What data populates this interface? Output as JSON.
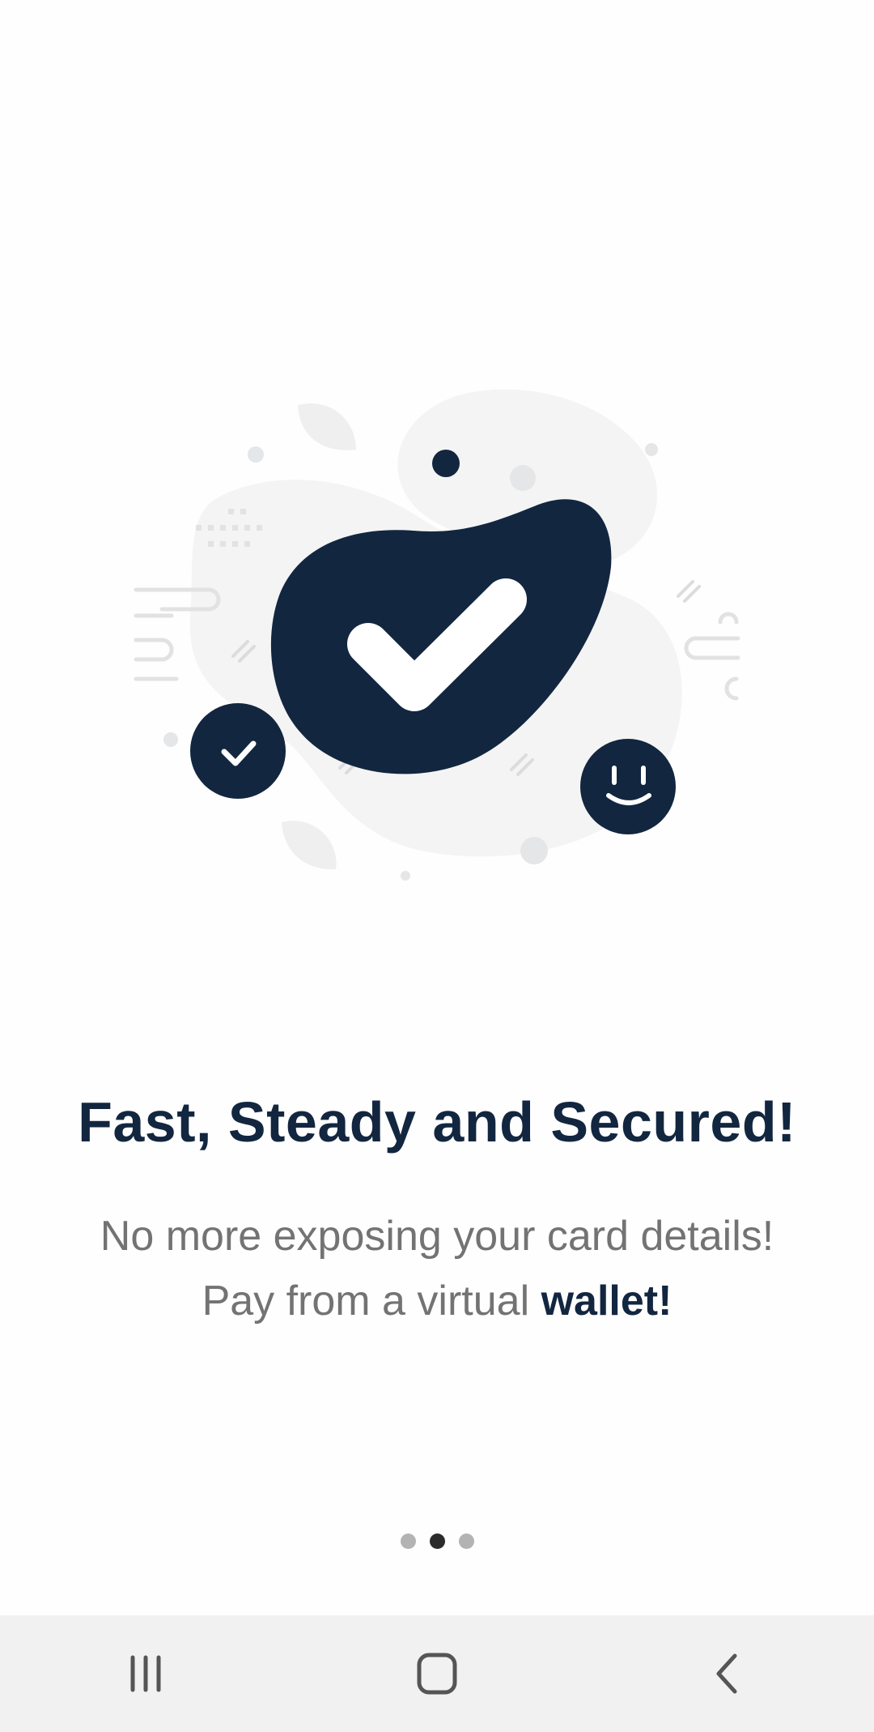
{
  "onboarding": {
    "title": "Fast, Steady and Secured!",
    "subtitle_line1": "No more exposing your card details!",
    "subtitle_line2_prefix": "Pay from a virtual ",
    "subtitle_line2_bold": "wallet!",
    "page_indicator": {
      "total": 3,
      "current": 2
    }
  },
  "illustration": {
    "icons": [
      "checkmark-blob-icon",
      "small-check-badge-icon",
      "smiley-badge-icon"
    ]
  },
  "system_nav": {
    "buttons": [
      "recent-apps",
      "home",
      "back"
    ]
  },
  "colors": {
    "brand_navy": "#12263f",
    "text_gray": "#737373",
    "navbar_bg": "#f1f1f1",
    "dot_inactive": "#b3b3b3",
    "dot_active": "#2b2b2b"
  }
}
